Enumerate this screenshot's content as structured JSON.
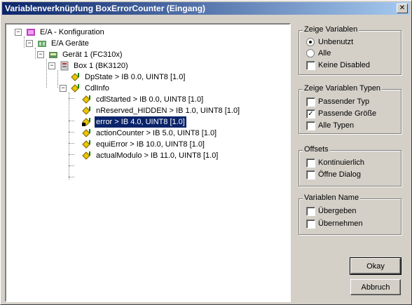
{
  "window": {
    "title": "Variablenverknüpfung BoxErrorCounter (Eingang)"
  },
  "tree": {
    "nodes": [
      {
        "label": "E/A - Konfiguration",
        "expander": "−",
        "icon": "io-config-icon"
      },
      {
        "label": "E/A Geräte",
        "expander": "−",
        "icon": "io-devices-icon"
      },
      {
        "label": "Gerät 1 (FC310x)",
        "expander": "−",
        "icon": "device-icon"
      },
      {
        "label": "Box 1 (BK3120)",
        "expander": "−",
        "icon": "box-icon"
      },
      {
        "label": "DpState   >   IB 0.0, UINT8 [1.0]",
        "icon": "variable-icon"
      },
      {
        "label": "CdlInfo",
        "expander": "−",
        "icon": "folder-variable-icon"
      },
      {
        "label": "cdlStarted   >   IB 0.0, UINT8 [1.0]",
        "icon": "variable-icon"
      },
      {
        "label": "nReserved_HIDDEN   >   IB 1.0, UINT8 [1.0]",
        "icon": "variable-icon"
      },
      {
        "label": "error   >   IB 4.0, UINT8 [1.0]",
        "icon": "variable-icon",
        "selected": true
      },
      {
        "label": "actionCounter   >   IB 5.0, UINT8 [1.0]",
        "icon": "variable-icon"
      },
      {
        "label": "equiError   >   IB 10.0, UINT8 [1.0]",
        "icon": "variable-icon"
      },
      {
        "label": "actualModulo   >   IB 11.0, UINT8 [1.0]",
        "icon": "variable-icon"
      }
    ]
  },
  "show_vars": {
    "legend": "Zeige Variablen",
    "options": [
      {
        "label": "Unbenutzt",
        "type": "radio",
        "checked": true
      },
      {
        "label": "Alle",
        "type": "radio",
        "checked": false
      },
      {
        "label": "Keine Disabled",
        "type": "checkbox",
        "checked": false
      }
    ]
  },
  "show_types": {
    "legend": "Zeige Variablen Typen",
    "options": [
      {
        "label": "Passender Typ",
        "checked": false
      },
      {
        "label": "Passende Größe",
        "checked": true
      },
      {
        "label": "Alle Typen",
        "checked": false
      }
    ]
  },
  "offsets": {
    "legend": "Offsets",
    "options": [
      {
        "label": "Kontinuierlich",
        "checked": false
      },
      {
        "label": "Öffne Dialog",
        "checked": false
      }
    ]
  },
  "var_name": {
    "legend": "Variablen Name",
    "options": [
      {
        "label": "Übergeben",
        "checked": false
      },
      {
        "label": "Übernehmen",
        "checked": false
      }
    ]
  },
  "buttons": {
    "ok": "Okay",
    "cancel": "Abbruch"
  },
  "colors": {
    "selection": "#0a246a",
    "variable_icon": "#e8c800",
    "face": "#d4d0c8"
  }
}
